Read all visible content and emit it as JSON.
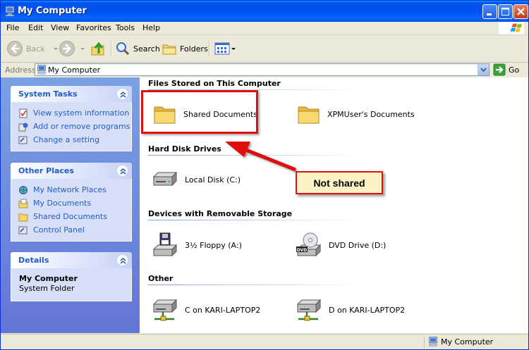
{
  "window": {
    "title": "My Computer"
  },
  "menu": [
    "File",
    "Edit",
    "View",
    "Favorites",
    "Tools",
    "Help"
  ],
  "toolbar": {
    "back": "Back",
    "search": "Search",
    "folders": "Folders"
  },
  "address": {
    "label": "Address",
    "value": "My Computer",
    "go": "Go"
  },
  "left": {
    "system_tasks": {
      "title": "System Tasks",
      "items": [
        "View system information",
        "Add or remove programs",
        "Change a setting"
      ]
    },
    "other_places": {
      "title": "Other Places",
      "items": [
        "My Network Places",
        "My Documents",
        "Shared Documents",
        "Control Panel"
      ]
    },
    "details": {
      "title": "Details",
      "name": "My Computer",
      "type": "System Folder"
    }
  },
  "groups": [
    {
      "title": "Files Stored on This Computer",
      "items": [
        "Shared Documents",
        "XPMUser's Documents"
      ]
    },
    {
      "title": "Hard Disk Drives",
      "items": [
        "Local Disk (C:)"
      ]
    },
    {
      "title": "Devices with Removable Storage",
      "items": [
        "3½ Floppy (A:)",
        "DVD Drive (D:)"
      ]
    },
    {
      "title": "Other",
      "items": [
        "C on KARI-LAPTOP2",
        "D on KARI-LAPTOP2"
      ]
    }
  ],
  "annotation": {
    "text": "Not shared"
  },
  "status": {
    "location": "My Computer"
  },
  "colors": {
    "titlebar": "#0053ee",
    "task_pane": "#6375d6",
    "link": "#215dc6",
    "annotation_red": "#e01010",
    "callout_bg": "#fcf3c5"
  }
}
